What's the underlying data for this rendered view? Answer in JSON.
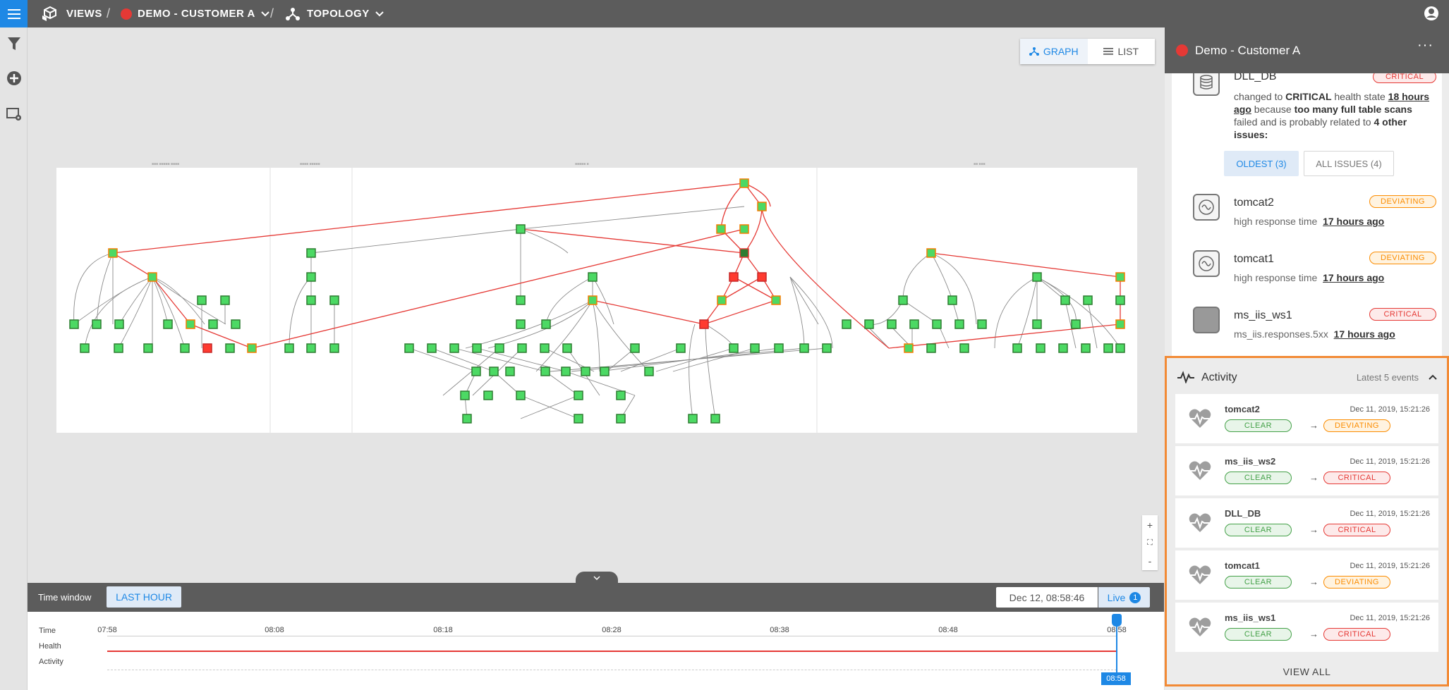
{
  "topbar": {
    "views_label": "VIEWS",
    "customer_label": "DEMO - CUSTOMER A",
    "topology_label": "TOPOLOGY",
    "separator": "/"
  },
  "view_toggle": {
    "graph_label": "GRAPH",
    "list_label": "LIST",
    "active": "graph"
  },
  "icons": [
    "menu-icon",
    "views-icon",
    "chevron-down-icon",
    "topology-icon",
    "user-icon",
    "filter-icon",
    "add-icon",
    "settings-icon",
    "graph-icon",
    "list-icon",
    "zoom-in-icon",
    "fit-icon",
    "zoom-out-icon",
    "heartbeat-icon",
    "chevron-up-icon",
    "activity-icon"
  ],
  "zoom": {
    "in": "+",
    "fit": "⛶",
    "out": "-"
  },
  "timeline": {
    "time_window_label": "Time window",
    "window_button": "LAST HOUR",
    "current_date": "Dec 12, 08:58:46",
    "live_label": "Live",
    "live_count": "1",
    "row_labels": [
      "Time",
      "Health",
      "Activity"
    ],
    "ticks": [
      "07:58",
      "08:08",
      "08:18",
      "08:28",
      "08:38",
      "08:48",
      "08:58"
    ],
    "cursor_label": "08:58"
  },
  "panel": {
    "title": "Demo - Customer A",
    "more": "···",
    "first_issue": {
      "name": "DLL_DB",
      "state": "CRITICAL",
      "desc_prefix": "changed to ",
      "desc_state": "CRITICAL",
      "desc_mid": " health state ",
      "desc_time": "18 hours ago",
      "desc_because": " because ",
      "desc_reason": "too many full table scans",
      "desc_tail": " failed and is probably related to ",
      "desc_count": "4 other issues:"
    },
    "tabs": {
      "oldest": "OLDEST (3)",
      "all": "ALL ISSUES (4)"
    },
    "issues": [
      {
        "name": "tomcat2",
        "state": "DEVIATING",
        "desc": "high response time",
        "time": "17 hours ago"
      },
      {
        "name": "tomcat1",
        "state": "DEVIATING",
        "desc": "high response time",
        "time": "17 hours ago"
      },
      {
        "name": "ms_iis_ws1",
        "state": "CRITICAL",
        "desc": "ms_iis.responses.5xx",
        "time": "17 hours ago"
      }
    ]
  },
  "activity": {
    "title": "Activity",
    "latest": "Latest 5 events",
    "view_all": "VIEW ALL",
    "arrow": "→",
    "events": [
      {
        "name": "tomcat2",
        "time": "Dec 11, 2019, 15:21:26",
        "from": "CLEAR",
        "to": "DEVIATING"
      },
      {
        "name": "ms_iis_ws2",
        "time": "Dec 11, 2019, 15:21:26",
        "from": "CLEAR",
        "to": "CRITICAL"
      },
      {
        "name": "DLL_DB",
        "time": "Dec 11, 2019, 15:21:26",
        "from": "CLEAR",
        "to": "CRITICAL"
      },
      {
        "name": "tomcat1",
        "time": "Dec 11, 2019, 15:21:26",
        "from": "CLEAR",
        "to": "DEVIATING"
      },
      {
        "name": "ms_iis_ws1",
        "time": "Dec 11, 2019, 15:21:26",
        "from": "CLEAR",
        "to": "CRITICAL"
      }
    ]
  },
  "colors": {
    "accent": "#1e88e5",
    "critical": "#e53935",
    "deviating": "#fb8c00",
    "clear": "#43a047",
    "highlight": "#f28a35"
  }
}
